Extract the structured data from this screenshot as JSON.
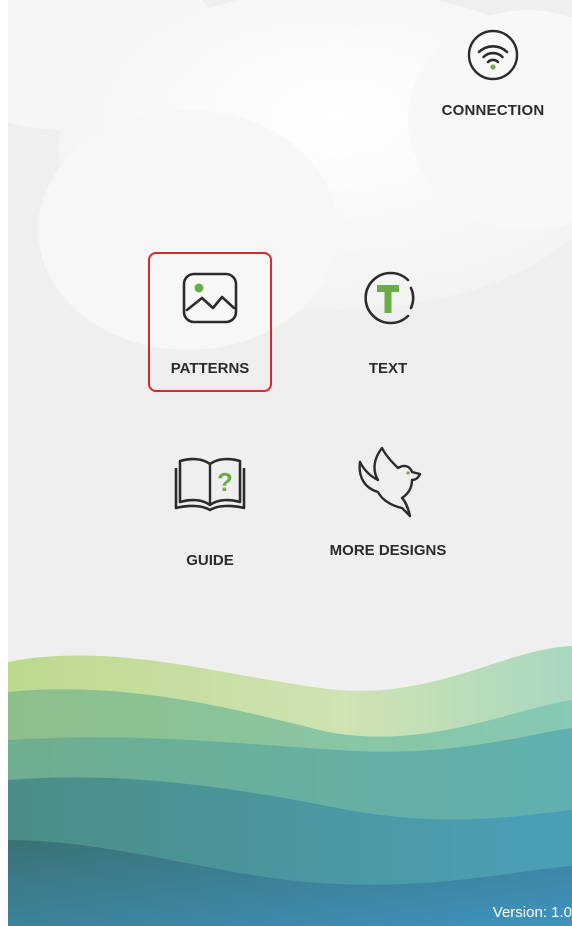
{
  "connection": {
    "label": "CONNECTION",
    "icon": "wifi-icon"
  },
  "menu": {
    "patterns": {
      "label": "PATTERNS",
      "icon": "image-icon",
      "selected": true
    },
    "text": {
      "label": "TEXT",
      "icon": "text-t-icon"
    },
    "guide": {
      "label": "GUIDE",
      "icon": "book-question-icon"
    },
    "more_designs": {
      "label": "MORE DESIGNS",
      "icon": "bird-icon"
    }
  },
  "footer": {
    "version": "Version: 1.0"
  },
  "colors": {
    "accent_green": "#6aad47",
    "selection_red": "#e0262b",
    "icon_stroke": "#2b2b2b",
    "background": "#efefef"
  }
}
